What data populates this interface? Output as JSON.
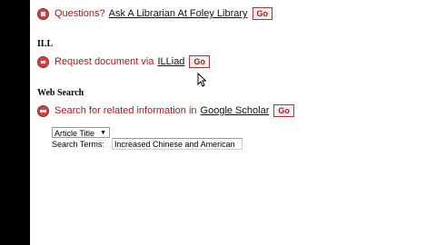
{
  "rows": {
    "questions": {
      "prompt": "Questions?",
      "link": "Ask A Librarian At Foley Library",
      "go": "Go"
    },
    "ill": {
      "heading": "ILL",
      "prompt": "Request document via",
      "link": "ILLiad",
      "go": "Go"
    },
    "web_search": {
      "heading": "Web Search",
      "prompt": "Search for related information in",
      "link": "Google Scholar",
      "go": "Go"
    }
  },
  "search_form": {
    "field_select": "Article Title",
    "terms_label": "Search Terms:",
    "terms_value": "Increased Chinese and American"
  },
  "icons": {
    "library": "red-circle-icon",
    "cursor": "mouse-pointer-icon"
  },
  "colors": {
    "prompt": "#9b1b1b",
    "icon": "#cc4444",
    "side_bar": "#000000"
  }
}
